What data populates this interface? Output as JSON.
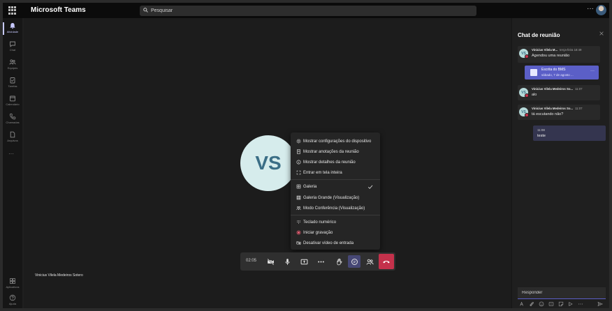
{
  "app": {
    "title": "Microsoft Teams"
  },
  "search": {
    "placeholder": "Pesquisar"
  },
  "topbar": {
    "more_label": "···"
  },
  "rail": {
    "items": [
      {
        "label": "Atividade",
        "icon": "bell-icon",
        "active": true
      },
      {
        "label": "Chat",
        "icon": "chat-icon"
      },
      {
        "label": "Equipes",
        "icon": "teams-icon"
      },
      {
        "label": "Tarefas",
        "icon": "tasks-icon"
      },
      {
        "label": "Calendário",
        "icon": "calendar-icon"
      },
      {
        "label": "Chamadas",
        "icon": "phone-icon"
      },
      {
        "label": "Arquivos",
        "icon": "files-icon"
      }
    ],
    "more_label": "···",
    "bottom": [
      {
        "label": "Aplicativos",
        "icon": "apps-icon"
      },
      {
        "label": "Ajuda",
        "icon": "help-icon"
      }
    ]
  },
  "stage": {
    "avatar_initials": "VS",
    "participant_name": "Vinicius Vilela Medeiros Sotero"
  },
  "menu": {
    "items": [
      {
        "label": "Mostrar configurações do dispositivo",
        "icon": "gear-icon"
      },
      {
        "label": "Mostrar anotações da reunião",
        "icon": "notes-icon"
      },
      {
        "label": "Mostrar detalhes da reunião",
        "icon": "info-icon"
      },
      {
        "label": "Entrar em tela inteira",
        "icon": "fullscreen-icon"
      },
      {
        "label": "Galeria",
        "icon": "gallery-icon",
        "checked": true
      },
      {
        "label": "Galeria Grande (Visualização)",
        "icon": "large-gallery-icon"
      },
      {
        "label": "Modo Conferência (Visualização)",
        "icon": "together-mode-icon"
      },
      {
        "label": "Teclado numérico",
        "icon": "dialpad-icon"
      },
      {
        "label": "Iniciar gravação",
        "icon": "record-icon"
      },
      {
        "label": "Desativar vídeo de entrada",
        "icon": "video-off-icon"
      }
    ]
  },
  "call": {
    "timer": "02:05",
    "controls": [
      "camera-off-icon",
      "mic-icon",
      "share-screen-icon",
      "more-icon",
      "raise-hand-icon",
      "chat-icon",
      "participants-icon",
      "hangup-icon"
    ]
  },
  "chat": {
    "title": "Chat de reunião",
    "messages": [
      {
        "initials": "VS",
        "author": "Vinicius Vilela M...",
        "time": "terça-feira 18:49",
        "text": "Agendou uma reunião"
      },
      {
        "initials": "VS",
        "author": "Vinicius Vilela Medeiros So...",
        "time": "11:07",
        "text": "alo"
      },
      {
        "initials": "VS",
        "author": "Vinicius Vilela Medeiros So...",
        "time": "11:07",
        "text": "tá escutando não?"
      }
    ],
    "meeting_card": {
      "title": "Escrita do BMS",
      "date": "sábado, 7 de agosto ..."
    },
    "own_message": {
      "time": "11:08",
      "text": "teste"
    },
    "compose_placeholder": "Responder"
  },
  "colors": {
    "accent": "#5b5fc7",
    "hangup": "#c4314b",
    "avatar_bg": "#d6ecec",
    "avatar_text": "#3b6e86"
  }
}
